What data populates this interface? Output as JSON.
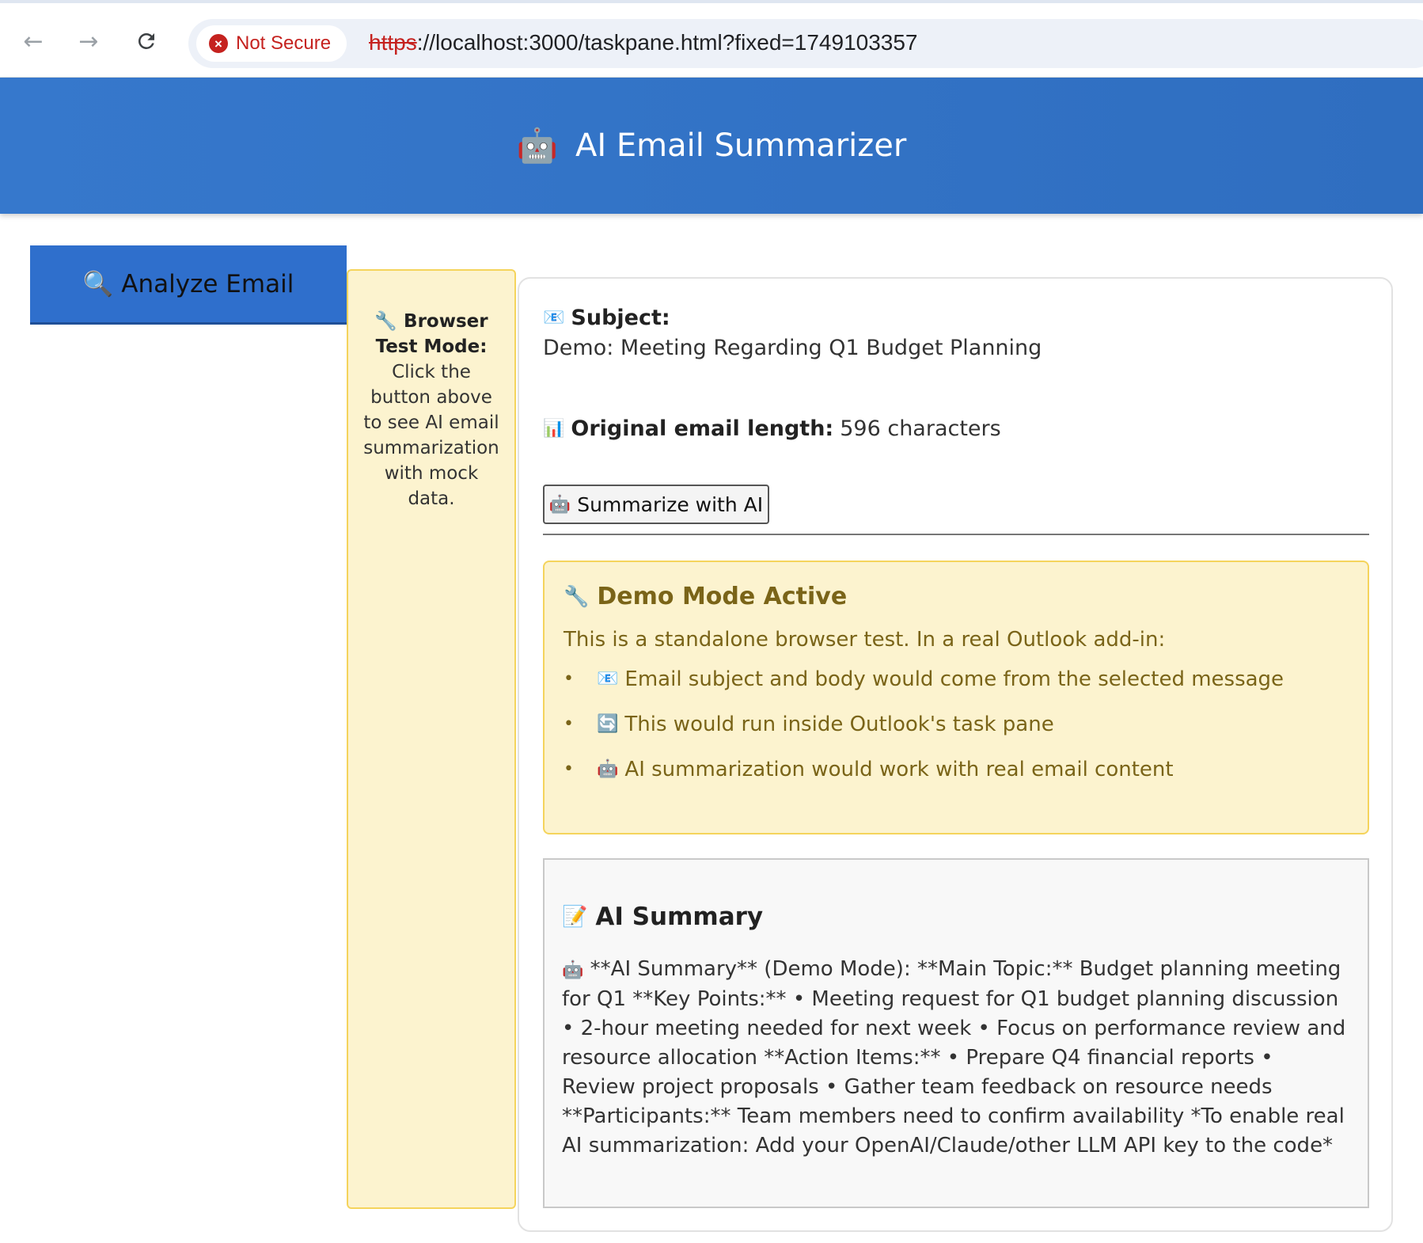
{
  "browser": {
    "back_icon": "arrow-left-icon",
    "forward_icon": "arrow-right-icon",
    "reload_icon": "reload-icon",
    "security_label": "Not Secure",
    "url_scheme": "https",
    "url_rest": "://localhost:3000/taskpane.html?fixed=1749103357"
  },
  "header": {
    "icon": "🤖",
    "title": "AI Email Summarizer"
  },
  "analyze_button": {
    "icon": "🔍",
    "label": "Analyze Email"
  },
  "test_note": {
    "icon": "🔧",
    "heading": "Browser Test Mode:",
    "text": "Click the button above to see AI email summarization with mock data."
  },
  "email": {
    "subject_icon": "📧",
    "subject_label": "Subject:",
    "subject_value": "Demo: Meeting Regarding Q1 Budget Planning",
    "length_icon": "📊",
    "length_label": "Original email length:",
    "length_value": "596 characters"
  },
  "summarize_button": {
    "icon": "🤖",
    "label": "Summarize with AI"
  },
  "demo_notice": {
    "icon": "🔧",
    "title": "Demo Mode Active",
    "intro": "This is a standalone browser test. In a real Outlook add-in:",
    "items": [
      {
        "icon": "📧",
        "text": "Email subject and body would come from the selected message"
      },
      {
        "icon": "🔄",
        "text": "This would run inside Outlook's task pane"
      },
      {
        "icon": "🤖",
        "text": "AI summarization would work with real email content"
      }
    ]
  },
  "summary": {
    "icon": "📝",
    "title": "AI Summary",
    "text_icon": "🤖",
    "text": "**AI Summary** (Demo Mode): **Main Topic:** Budget planning meeting for Q1 **Key Points:** • Meeting request for Q1 budget planning discussion • 2-hour meeting needed for next week • Focus on performance review and resource allocation **Action Items:** • Prepare Q4 financial reports • Review project proposals • Gather team feedback on resource needs **Participants:** Team members need to confirm availability *To enable real AI summarization: Add your OpenAI/Claude/other LLM API key to the code*"
  },
  "colors": {
    "header_blue": "#3678cc",
    "button_blue": "#2f6fcc",
    "note_yellow": "#fcf3cf",
    "note_border": "#f5d45c",
    "note_text": "#7a6418",
    "insecure_red": "#c5221f"
  }
}
